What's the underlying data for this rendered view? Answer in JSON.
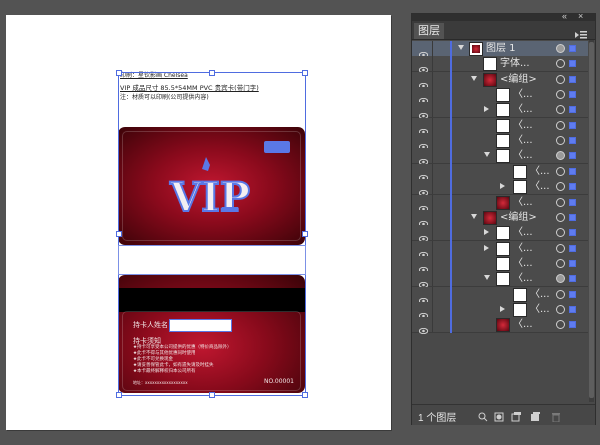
{
  "artwork": {
    "header_lines": [
      "印刷：星钦影画    Chelsea",
      "VIP 成品尺寸 85.5*54MM PVC 贵宾卡(带门字)",
      "注：材质可以印刷(公司提供内容)"
    ],
    "front": {
      "logo_text": "VIP"
    },
    "back": {
      "holder_name_label": "持卡人姓名",
      "notice_title": "持卡须知",
      "notice_lines": [
        "★持卡可享受本公司提供的优惠（特价商品除外）",
        "★此卡不得与其他优惠同时使用",
        "★此卡不可兑换现金",
        "★请妥善保管此卡，如有遗失请及时挂失",
        "★本卡最终解释权归本公司所有"
      ],
      "footer_line": "地址：xxxxxxxxxxxxxxxxxx",
      "card_number": "NO.00001"
    }
  },
  "panel": {
    "top_controls": {
      "collapse": "«",
      "close": "×"
    },
    "tab_label": "图层",
    "menu_icon": "panel-menu-icon",
    "layer_count": "1 个图层",
    "rows": [
      {
        "label": "图层 1",
        "level": 0,
        "expand": "open",
        "thumb": "logo",
        "target": "filled",
        "selected": true
      },
      {
        "label": "字体...",
        "level": 1,
        "expand": "none",
        "thumb": "white",
        "target": "empty",
        "selected": false
      },
      {
        "label": "<编组>",
        "level": 1,
        "expand": "open",
        "thumb": "red",
        "target": "empty",
        "selected": false
      },
      {
        "label": "〈...",
        "level": 2,
        "expand": "none",
        "thumb": "white",
        "target": "empty",
        "selected": false
      },
      {
        "label": "〈...",
        "level": 2,
        "expand": "closed",
        "thumb": "white",
        "target": "empty",
        "selected": false
      },
      {
        "label": "〈...",
        "level": 2,
        "expand": "none",
        "thumb": "white",
        "target": "empty",
        "selected": false
      },
      {
        "label": "〈...",
        "level": 2,
        "expand": "none",
        "thumb": "white",
        "target": "empty",
        "selected": false
      },
      {
        "label": "〈...",
        "level": 2,
        "expand": "open",
        "thumb": "white",
        "target": "filled",
        "selected": false
      },
      {
        "label": "〈...",
        "level": 3,
        "expand": "none",
        "thumb": "white",
        "target": "empty",
        "selected": false
      },
      {
        "label": "〈...",
        "level": 3,
        "expand": "closed",
        "thumb": "white",
        "target": "empty",
        "selected": false
      },
      {
        "label": "〈...",
        "level": 2,
        "expand": "none",
        "thumb": "red",
        "target": "empty",
        "selected": false
      },
      {
        "label": "<编组>",
        "level": 1,
        "expand": "open",
        "thumb": "red",
        "target": "empty",
        "selected": false
      },
      {
        "label": "〈...",
        "level": 2,
        "expand": "closed",
        "thumb": "white",
        "target": "empty",
        "selected": false
      },
      {
        "label": "〈...",
        "level": 2,
        "expand": "closed",
        "thumb": "white",
        "target": "empty",
        "selected": false
      },
      {
        "label": "〈...",
        "level": 2,
        "expand": "none",
        "thumb": "white",
        "target": "empty",
        "selected": false
      },
      {
        "label": "〈...",
        "level": 2,
        "expand": "open",
        "thumb": "white",
        "target": "filled",
        "selected": false
      },
      {
        "label": "〈...",
        "level": 3,
        "expand": "none",
        "thumb": "white",
        "target": "empty",
        "selected": false
      },
      {
        "label": "〈...",
        "level": 3,
        "expand": "closed",
        "thumb": "white",
        "target": "empty",
        "selected": false
      },
      {
        "label": "〈...",
        "level": 2,
        "expand": "none",
        "thumb": "red",
        "target": "empty",
        "selected": false
      }
    ],
    "bottom_icons": [
      "locate-object-icon",
      "make-clipping-mask-icon",
      "new-sublayer-icon",
      "new-layer-icon",
      "delete-icon"
    ]
  },
  "colors": {
    "selection": "#4f6ce0",
    "card_red": "#c01730",
    "canvas_bg": "#535353"
  }
}
